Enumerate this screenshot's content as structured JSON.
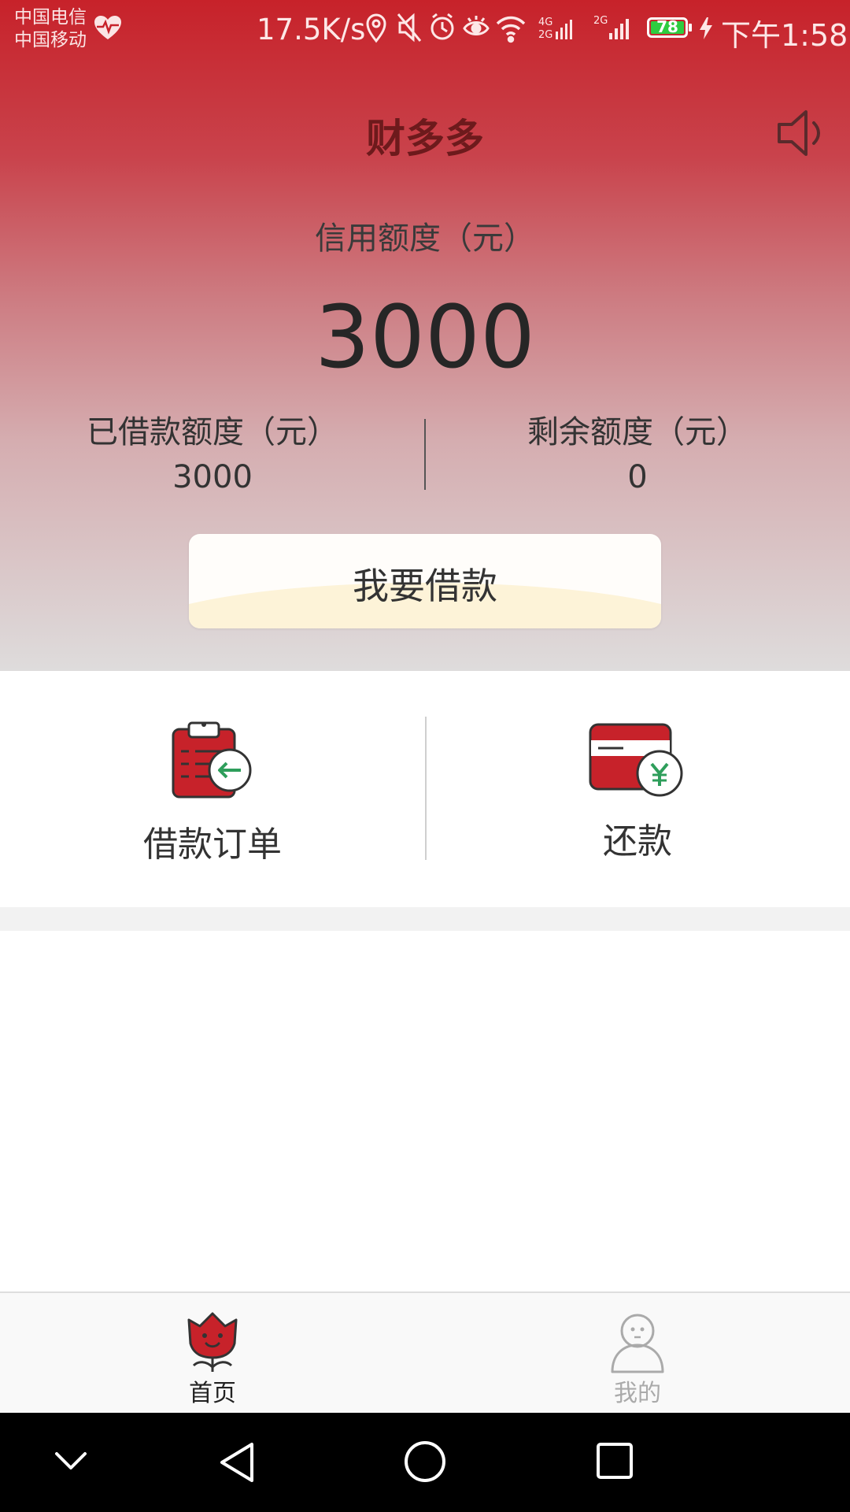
{
  "status_bar": {
    "carrier1": "中国电信",
    "carrier2": "中国移动",
    "speed": "17.5K/s",
    "network_labels": [
      "4G",
      "2G",
      "2G"
    ],
    "battery": "78",
    "time": "下午1:58"
  },
  "header": {
    "title": "财多多",
    "speaker_icon": "speaker-icon"
  },
  "credit": {
    "label": "信用额度（元）",
    "amount": "3000",
    "borrowed_label": "已借款额度（元）",
    "borrowed_value": "3000",
    "remaining_label": "剩余额度（元）",
    "remaining_value": "0"
  },
  "borrow_button": {
    "label": "我要借款"
  },
  "actions": [
    {
      "label": "借款订单",
      "icon": "clipboard-return-icon"
    },
    {
      "label": "还款",
      "icon": "card-yuan-icon"
    }
  ],
  "tabs": [
    {
      "label": "首页",
      "icon": "flower-home-icon",
      "active": true
    },
    {
      "label": "我的",
      "icon": "person-icon",
      "active": false
    }
  ],
  "colors": {
    "brand_red": "#c7222a",
    "title_dark_red": "#6d1a1c",
    "green_accent": "#2e9e5b",
    "tab_active": "#222222",
    "tab_inactive": "#aaaaaa"
  },
  "nav_icons": [
    "chevron-down-icon",
    "back-icon",
    "home-circle-icon",
    "recents-square-icon"
  ]
}
